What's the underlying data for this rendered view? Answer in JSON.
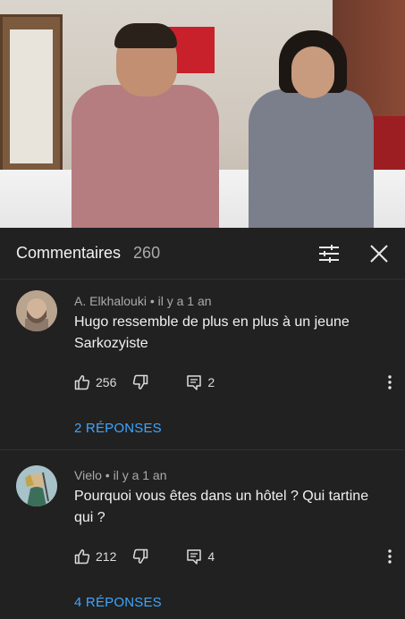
{
  "header": {
    "title": "Commentaires",
    "count": "260"
  },
  "icons": {
    "filter": "sort-sliders-icon",
    "close": "close-icon",
    "like": "thumbs-up-icon",
    "dislike": "thumbs-down-icon",
    "reply": "reply-comment-icon",
    "more": "more-vert-icon"
  },
  "colors": {
    "background": "#212121",
    "link": "#3ea6ff",
    "meta": "#aaaaaa"
  },
  "comments": [
    {
      "author": "A. Elkhalouki",
      "time": "il y a 1 an",
      "text": "Hugo ressemble de plus en plus à un jeune Sarkozyiste",
      "likes": "256",
      "replies": "2",
      "replies_label": "2 RÉPONSES"
    },
    {
      "author": "Vielo",
      "time": "il y a 1 an",
      "text": "Pourquoi vous êtes dans un hôtel ? Qui tartine qui ?",
      "likes": "212",
      "replies": "4",
      "replies_label": "4 RÉPONSES"
    }
  ]
}
